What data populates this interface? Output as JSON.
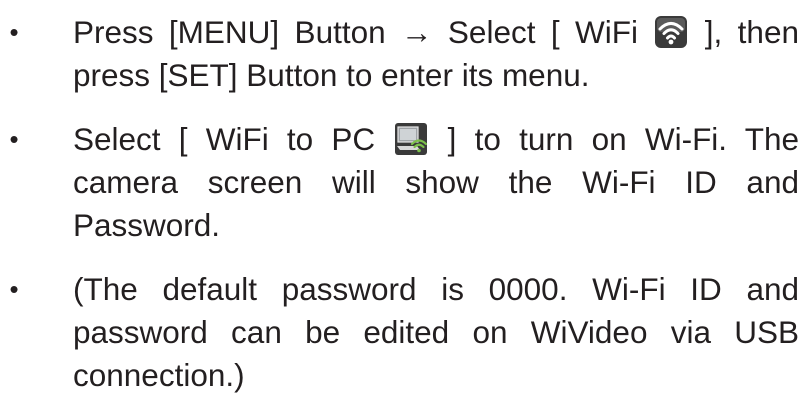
{
  "bullet_char": "•",
  "items": [
    {
      "pre": "Press [MENU] Button → Select [ WiFi ",
      "post": " ], then press [SET] Button to enter its menu.",
      "icon": "wifi-icon"
    },
    {
      "pre": "Select [ WiFi to PC ",
      "post": " ] to turn on Wi-Fi.  The camera screen will show the Wi-Fi ID and Password.",
      "icon": "wifi-to-pc-icon"
    },
    {
      "text": "(The default password is 0000. Wi-Fi ID and password can be edited on WiVideo via USB connection.)"
    }
  ],
  "colors": {
    "text": "#231f20",
    "icon_frame": "#3a3a3a",
    "wifi_green": "#7cc04a"
  }
}
